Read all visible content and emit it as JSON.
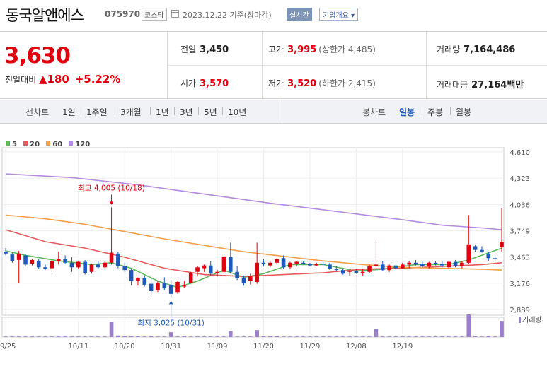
{
  "header": {
    "name": "동국알앤에스",
    "code": "075970",
    "market": "코스닥",
    "date": "2023.12.22",
    "basis": "기준(장마감)",
    "realtime": "실시간",
    "company_info": "기업개요"
  },
  "quote": {
    "price": "3,630",
    "change_label": "전일대비",
    "change": "180",
    "change_pct": "+5.22%",
    "prev_label": "전일",
    "prev": "3,450",
    "open_label": "시가",
    "open": "3,570",
    "high_label": "고가",
    "high": "3,995",
    "upper_limit": "(상한가 4,485)",
    "low_label": "저가",
    "low": "3,520",
    "lower_limit": "(하한가 2,415)",
    "volume_label": "거래량",
    "volume": "7,164,486",
    "amount_label": "거래대금",
    "amount": "27,164",
    "amount_unit": "백만"
  },
  "period_bar": {
    "line_label": "선차트",
    "periods": [
      "1일",
      "1주일",
      "3개월",
      "1년",
      "3년",
      "5년",
      "10년"
    ],
    "candle_label": "봉차트",
    "candle_periods": [
      "일봉",
      "주봉",
      "월봉"
    ],
    "active_candle": "일봉"
  },
  "legend": [
    {
      "name": "5",
      "color": "#5cb85c"
    },
    {
      "name": "20",
      "color": "#e55a5a"
    },
    {
      "name": "60",
      "color": "#f5a04a"
    },
    {
      "name": "120",
      "color": "#b48be0"
    }
  ],
  "colors": {
    "up": "#e2000f",
    "down": "#1e5abc",
    "vol": "#9b7fcc"
  },
  "chart_data": {
    "type": "candlestick",
    "y_ticks": [
      4610,
      4323,
      4036,
      3749,
      3463,
      3176,
      2889
    ],
    "y_tick_labels": [
      "4,610",
      "4,323",
      "4,036",
      "3,749",
      "3,463",
      "3,176",
      "2,889"
    ],
    "ylim": [
      2889,
      4610
    ],
    "x_labels": [
      "09/25",
      "10/11",
      "10/20",
      "10/31",
      "11/09",
      "11/20",
      "11/29",
      "12/08",
      "12/19"
    ],
    "x_label_index": [
      0,
      11,
      18,
      25,
      32,
      39,
      46,
      53,
      60
    ],
    "annotations": [
      {
        "text": "최고 4,005 (10/18)",
        "index": 16,
        "value": 4005,
        "kind": "high"
      },
      {
        "text": "최저 3,025 (10/31)",
        "index": 25,
        "value": 3025,
        "kind": "low"
      }
    ],
    "volume_label": "거래량",
    "candles": [
      [
        3520,
        3560,
        3480,
        3500
      ],
      [
        3490,
        3510,
        3400,
        3420
      ],
      [
        3430,
        3530,
        3180,
        3500
      ],
      [
        3480,
        3490,
        3360,
        3380
      ],
      [
        3390,
        3440,
        3370,
        3430
      ],
      [
        3420,
        3440,
        3330,
        3350
      ],
      [
        3350,
        3380,
        3320,
        3330
      ],
      [
        3340,
        3430,
        3300,
        3420
      ],
      [
        3420,
        3520,
        3380,
        3440
      ],
      [
        3440,
        3480,
        3390,
        3400
      ],
      [
        3400,
        3460,
        3300,
        3350
      ],
      [
        3350,
        3420,
        3330,
        3410
      ],
      [
        3410,
        3430,
        3270,
        3290
      ],
      [
        3300,
        3390,
        3280,
        3380
      ],
      [
        3380,
        3420,
        3340,
        3350
      ],
      [
        3350,
        3420,
        3340,
        3400
      ],
      [
        3400,
        4005,
        3380,
        3510
      ],
      [
        3500,
        3520,
        3340,
        3360
      ],
      [
        3360,
        3400,
        3300,
        3320
      ],
      [
        3320,
        3330,
        3150,
        3200
      ],
      [
        3200,
        3240,
        3150,
        3230
      ],
      [
        3230,
        3260,
        3140,
        3160
      ],
      [
        3170,
        3230,
        3050,
        3090
      ],
      [
        3100,
        3200,
        3080,
        3180
      ],
      [
        3180,
        3240,
        3100,
        3120
      ],
      [
        3160,
        3210,
        3025,
        3060
      ],
      [
        3080,
        3200,
        3060,
        3190
      ],
      [
        3140,
        3200,
        3120,
        3150
      ],
      [
        3180,
        3300,
        3170,
        3290
      ],
      [
        3300,
        3360,
        3250,
        3350
      ],
      [
        3340,
        3380,
        3300,
        3370
      ],
      [
        3370,
        3420,
        3260,
        3280
      ],
      [
        3290,
        3320,
        3250,
        3300
      ],
      [
        3300,
        3480,
        3290,
        3460
      ],
      [
        3460,
        3620,
        3280,
        3300
      ],
      [
        3300,
        3360,
        3210,
        3230
      ],
      [
        3230,
        3260,
        3150,
        3180
      ],
      [
        3200,
        3280,
        3160,
        3250
      ],
      [
        3190,
        3620,
        3170,
        3400
      ],
      [
        3400,
        3440,
        3360,
        3390
      ],
      [
        3370,
        3420,
        3350,
        3400
      ],
      [
        3400,
        3450,
        3380,
        3440
      ],
      [
        3450,
        3480,
        3330,
        3350
      ],
      [
        3350,
        3410,
        3330,
        3400
      ],
      [
        3390,
        3420,
        3360,
        3410
      ],
      [
        3400,
        3420,
        3380,
        3390
      ],
      [
        3390,
        3400,
        3360,
        3370
      ],
      [
        3370,
        3400,
        3360,
        3390
      ],
      [
        3390,
        3410,
        3370,
        3380
      ],
      [
        3380,
        3400,
        3320,
        3330
      ],
      [
        3330,
        3360,
        3300,
        3320
      ],
      [
        3320,
        3330,
        3270,
        3280
      ],
      [
        3300,
        3320,
        3260,
        3310
      ],
      [
        3310,
        3330,
        3280,
        3290
      ],
      [
        3290,
        3330,
        3260,
        3300
      ],
      [
        3300,
        3380,
        3290,
        3360
      ],
      [
        3360,
        3650,
        3340,
        3380
      ],
      [
        3380,
        3420,
        3310,
        3320
      ],
      [
        3320,
        3380,
        3300,
        3370
      ],
      [
        3370,
        3390,
        3320,
        3340
      ],
      [
        3340,
        3400,
        3330,
        3380
      ],
      [
        3380,
        3420,
        3340,
        3400
      ],
      [
        3400,
        3430,
        3370,
        3380
      ],
      [
        3390,
        3420,
        3350,
        3360
      ],
      [
        3360,
        3410,
        3340,
        3400
      ],
      [
        3400,
        3420,
        3370,
        3390
      ],
      [
        3390,
        3420,
        3350,
        3370
      ],
      [
        3350,
        3420,
        3340,
        3410
      ],
      [
        3410,
        3430,
        3350,
        3360
      ],
      [
        3360,
        3420,
        3340,
        3400
      ],
      [
        3400,
        3920,
        3390,
        3600
      ],
      [
        3580,
        3600,
        3520,
        3540
      ],
      [
        3540,
        3580,
        3510,
        3520
      ],
      [
        3500,
        3520,
        3420,
        3450
      ],
      [
        3450,
        3470,
        3420,
        3440
      ],
      [
        3570,
        3995,
        3520,
        3630
      ]
    ],
    "volumes": [
      1,
      1,
      1,
      1,
      1,
      1,
      1,
      1,
      1,
      1,
      1,
      1,
      1,
      1,
      1,
      1,
      28,
      3,
      2,
      2,
      2,
      1,
      2,
      1,
      1,
      9,
      1,
      2,
      1,
      1,
      1,
      1,
      1,
      1,
      11,
      1,
      1,
      1,
      13,
      2,
      2,
      2,
      1,
      1,
      1,
      1,
      1,
      1,
      1,
      1,
      1,
      1,
      1,
      1,
      1,
      1,
      15,
      1,
      1,
      1,
      1,
      1,
      1,
      1,
      1,
      1,
      1,
      1,
      1,
      1,
      42,
      2,
      1,
      2,
      1,
      30
    ],
    "ma_lines": {
      "ma5": [
        [
          0,
          3530
        ],
        [
          3,
          3480
        ],
        [
          8,
          3420
        ],
        [
          13,
          3380
        ],
        [
          16,
          3400
        ],
        [
          19,
          3340
        ],
        [
          23,
          3200
        ],
        [
          26,
          3130
        ],
        [
          29,
          3200
        ],
        [
          33,
          3320
        ],
        [
          36,
          3240
        ],
        [
          39,
          3280
        ],
        [
          43,
          3380
        ],
        [
          48,
          3380
        ],
        [
          53,
          3310
        ],
        [
          57,
          3330
        ],
        [
          62,
          3380
        ],
        [
          67,
          3380
        ],
        [
          70,
          3430
        ],
        [
          75,
          3560
        ]
      ],
      "ma20": [
        [
          0,
          3760
        ],
        [
          6,
          3630
        ],
        [
          12,
          3560
        ],
        [
          18,
          3460
        ],
        [
          24,
          3340
        ],
        [
          30,
          3270
        ],
        [
          36,
          3250
        ],
        [
          42,
          3270
        ],
        [
          48,
          3290
        ],
        [
          54,
          3330
        ],
        [
          60,
          3340
        ],
        [
          66,
          3360
        ],
        [
          72,
          3380
        ],
        [
          75,
          3400
        ]
      ],
      "ma60": [
        [
          0,
          3920
        ],
        [
          6,
          3880
        ],
        [
          12,
          3820
        ],
        [
          18,
          3740
        ],
        [
          24,
          3660
        ],
        [
          30,
          3590
        ],
        [
          36,
          3520
        ],
        [
          42,
          3470
        ],
        [
          48,
          3420
        ],
        [
          54,
          3380
        ],
        [
          60,
          3350
        ],
        [
          66,
          3340
        ],
        [
          72,
          3330
        ],
        [
          75,
          3320
        ]
      ],
      "ma120": [
        [
          0,
          4370
        ],
        [
          10,
          4330
        ],
        [
          20,
          4250
        ],
        [
          30,
          4150
        ],
        [
          40,
          4050
        ],
        [
          50,
          3960
        ],
        [
          60,
          3870
        ],
        [
          66,
          3810
        ],
        [
          72,
          3780
        ],
        [
          75,
          3760
        ]
      ]
    }
  }
}
